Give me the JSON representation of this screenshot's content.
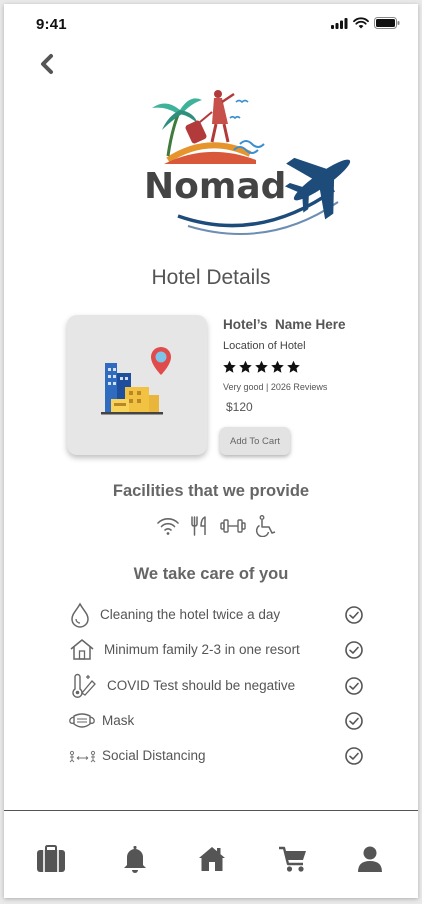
{
  "status_bar": {
    "time": "9:41"
  },
  "brand": {
    "logo_text": "Nomad"
  },
  "page": {
    "title": "Hotel Details"
  },
  "hotel": {
    "name": "Hotel’s  Name Here",
    "location": "Location of Hotel",
    "stars": 5,
    "rating_text": "Very good | 2026 Reviews",
    "price": "$120",
    "add_to_cart_label": "Add To Cart"
  },
  "facilities": {
    "heading": "Facilities that we provide",
    "icons": [
      "wifi-icon",
      "restaurant-icon",
      "gym-icon",
      "wheelchair-icon"
    ]
  },
  "care": {
    "heading": "We take care of you",
    "items": [
      {
        "icon": "water-drop-icon",
        "label": "Cleaning the hotel twice a day",
        "checked": true
      },
      {
        "icon": "house-icon",
        "label": "Minimum family 2-3 in one resort",
        "checked": true
      },
      {
        "icon": "thermometer-icon",
        "label": "COVID Test should be negative",
        "checked": true
      },
      {
        "icon": "mask-icon",
        "label": "Mask",
        "checked": true
      },
      {
        "icon": "distancing-icon",
        "label": "Social Distancing",
        "checked": true
      }
    ]
  },
  "tabbar": {
    "items": [
      "briefcase-icon",
      "bell-icon",
      "home-icon",
      "cart-icon",
      "user-icon"
    ]
  },
  "colors": {
    "brand_blue": "#1d4b7a",
    "brand_red": "#b33a3a",
    "text_gray": "#555555"
  }
}
